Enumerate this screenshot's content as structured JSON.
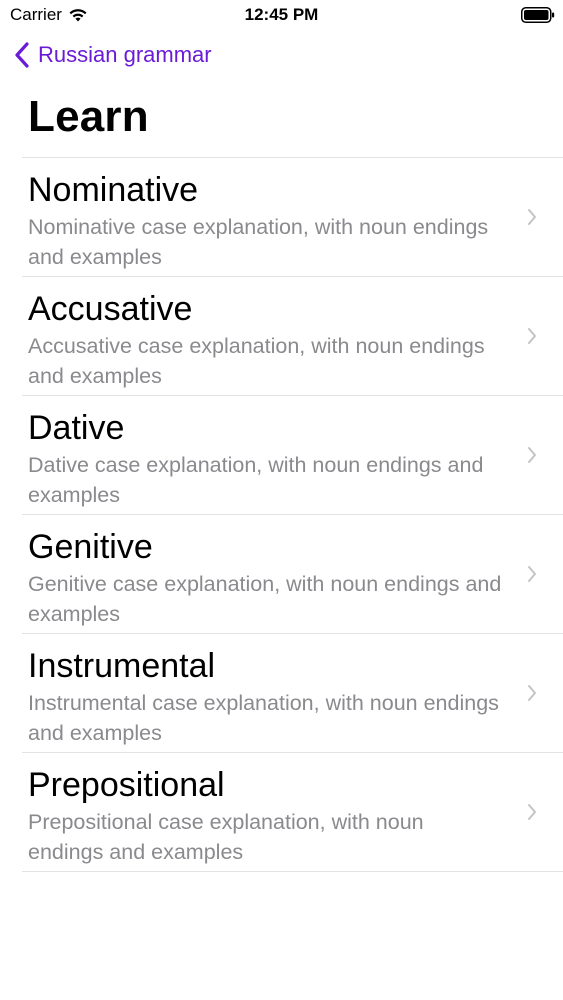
{
  "status_bar": {
    "carrier": "Carrier",
    "time": "12:45 PM"
  },
  "nav": {
    "back_label": "Russian grammar",
    "accent_color": "#6a1bd6"
  },
  "page": {
    "title": "Learn"
  },
  "items": [
    {
      "title": "Nominative",
      "subtitle": "Nominative case explanation, with noun endings and examples"
    },
    {
      "title": "Accusative",
      "subtitle": "Accusative case explanation, with noun endings and examples"
    },
    {
      "title": "Dative",
      "subtitle": "Dative case explanation, with noun endings and examples"
    },
    {
      "title": "Genitive",
      "subtitle": "Genitive case explanation, with noun endings and examples"
    },
    {
      "title": "Instrumental",
      "subtitle": "Instrumental case explanation, with noun endings and examples"
    },
    {
      "title": "Prepositional",
      "subtitle": "Prepositional case explanation, with noun endings and examples"
    }
  ]
}
